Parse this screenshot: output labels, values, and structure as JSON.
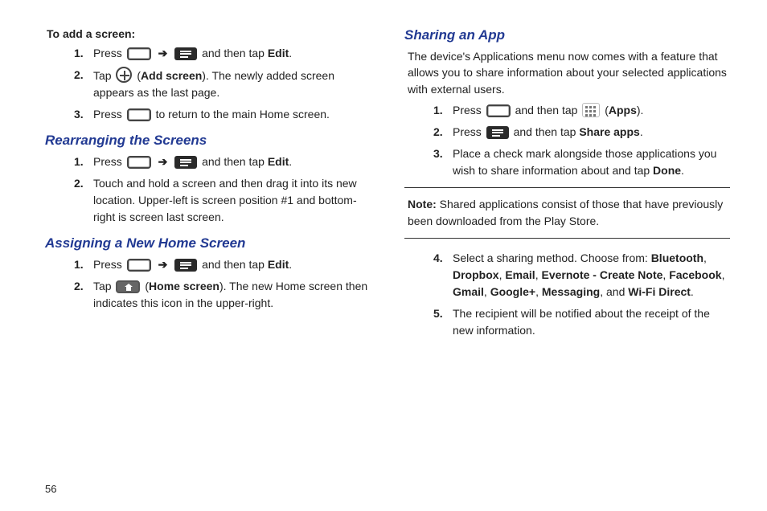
{
  "page_number": "56",
  "left": {
    "add_screen": {
      "title": "To add a screen:",
      "steps": [
        {
          "pre": "Press",
          "mid": "and then tap",
          "bold_end": "Edit",
          "after": "."
        },
        {
          "pre": "Tap",
          "paren_bold": "Add screen",
          "rest": "). The newly added screen appears as the last page."
        },
        {
          "pre": "Press",
          "rest": "to return to the main Home screen."
        }
      ]
    },
    "rearranging": {
      "title": "Rearranging the Screens",
      "steps": [
        {
          "pre": "Press",
          "mid": "and then tap",
          "bold_end": "Edit",
          "after": "."
        },
        {
          "text": "Touch and hold a screen and then drag it into its new location. Upper-left is screen position #1 and bottom-right is screen last screen."
        }
      ]
    },
    "assigning": {
      "title": "Assigning a New Home Screen",
      "steps": [
        {
          "pre": "Press",
          "mid": "and then tap",
          "bold_end": "Edit",
          "after": "."
        },
        {
          "pre": "Tap",
          "paren_bold": "Home screen",
          "rest": "). The new Home screen then indicates this icon in the upper-right."
        }
      ]
    }
  },
  "right": {
    "sharing": {
      "title": "Sharing an App",
      "intro": "The device's Applications menu now comes with a feature that allows you to share information about your selected applications with external users.",
      "steps123": [
        {
          "pre": "Press",
          "mid": "and then tap",
          "paren_bold": "Apps",
          "after": ")."
        },
        {
          "pre": "Press",
          "mid": "and then tap",
          "bold_end": "Share apps",
          "after": "."
        },
        {
          "text_a": "Place a check mark alongside those applications you wish to share information about and tap ",
          "bold_end": "Done",
          "after": "."
        }
      ],
      "note_label": "Note:",
      "note_text": "Shared applications consist of those that have previously been downloaded from the Play Store.",
      "step4": {
        "pre": "Select a sharing method. Choose from: ",
        "items": [
          "Bluetooth",
          "Dropbox",
          "Email",
          "Evernote - Create Note",
          "Facebook",
          "Gmail",
          "Google+",
          "Messaging"
        ],
        "last_conj": ", and ",
        "last": "Wi-Fi Direct",
        "after": "."
      },
      "step5": "The recipient will be notified about the receipt of the new information."
    }
  }
}
